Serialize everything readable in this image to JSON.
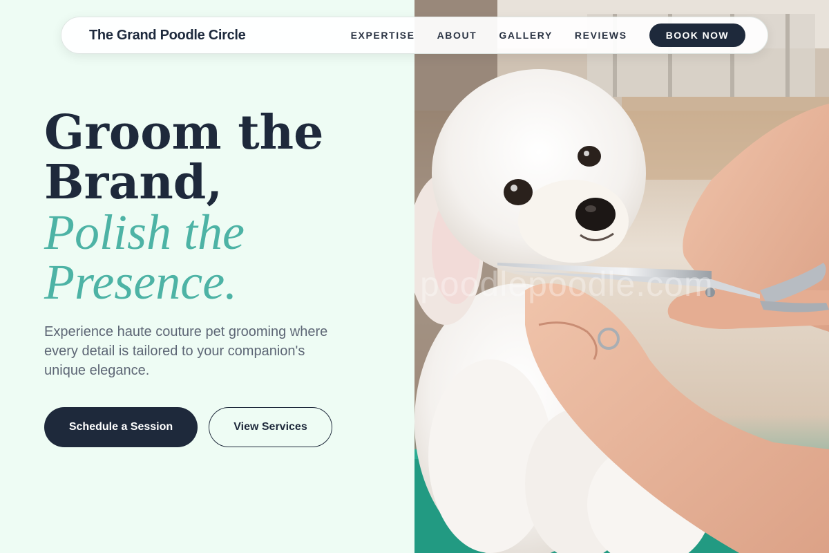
{
  "nav": {
    "brand": "The Grand Poodle Circle",
    "links": [
      "EXPERTISE",
      "ABOUT",
      "GALLERY",
      "REVIEWS"
    ],
    "cta": "BOOK NOW"
  },
  "hero": {
    "headline_line1": "Groom the",
    "headline_line2": "Brand,",
    "accent_line1": "Polish the",
    "accent_line2": "Presence.",
    "subtitle": "Experience haute couture pet grooming where every detail is tailored to your companion's unique elegance.",
    "primary_button": "Schedule a Session",
    "secondary_button": "View Services",
    "photo_watermark": "poodlepoodle.com"
  },
  "colors": {
    "background": "#eefcf4",
    "navy": "#1e293b",
    "teal_accent": "#4db3a5",
    "body_text": "#5d6675"
  },
  "icons": {
    "photo": "poodle-grooming-photo"
  }
}
